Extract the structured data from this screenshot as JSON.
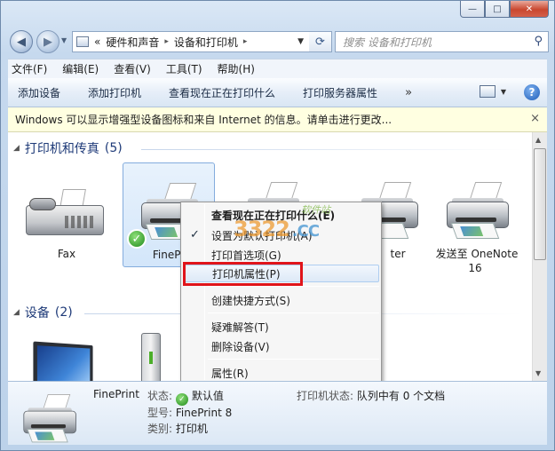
{
  "window": {
    "caption_buttons": {
      "minimize": "—",
      "maximize": "□",
      "close": "✕"
    }
  },
  "nav": {
    "back_icon": "◀",
    "forward_icon": "▶",
    "address": {
      "prefix": "«",
      "segments": [
        "硬件和声音",
        "设备和打印机"
      ],
      "separator": "▸"
    },
    "search_placeholder": "搜索 设备和打印机"
  },
  "menubar": [
    "文件(F)",
    "编辑(E)",
    "查看(V)",
    "工具(T)",
    "帮助(H)"
  ],
  "commandbar": {
    "items": [
      "添加设备",
      "添加打印机",
      "查看现在正在打印什么",
      "打印服务器属性"
    ],
    "more": "»",
    "help": "?"
  },
  "infobar": {
    "text": "Windows 可以显示增强型设备图标和来自 Internet 的信息。请单击进行更改...",
    "close": "×"
  },
  "groups": {
    "printers": {
      "title": "打印机和传真",
      "count": "(5)"
    },
    "devices": {
      "title": "设备",
      "count": "(2)"
    }
  },
  "printers": [
    {
      "label": "Fax"
    },
    {
      "label": "FinePr",
      "selected": true
    },
    {
      "label": ""
    },
    {
      "label": "ter"
    },
    {
      "label": "发送至 OneNote",
      "label2": "16"
    }
  ],
  "context_menu": {
    "items": [
      {
        "label": "查看现在正在打印什么(E)",
        "bold": true
      },
      {
        "label": "设置为默认打印机(A)",
        "checked": true
      },
      {
        "label": "打印首选项(G)"
      },
      {
        "label": "打印机属性(P)",
        "highlighted": true
      },
      {
        "label": "创建快捷方式(S)"
      },
      {
        "label": "疑难解答(T)"
      },
      {
        "label": "删除设备(V)"
      },
      {
        "label": "属性(R)"
      }
    ],
    "check_icon": "✓"
  },
  "watermark": {
    "main": "3322",
    "suffix": ".CC",
    "sub": "软件站"
  },
  "details": {
    "name": "FinePrint",
    "status_key": "状态:",
    "status_value": "默认值",
    "model_key": "型号:",
    "model_value": "FinePrint 8",
    "category_key": "类别:",
    "category_value": "打印机",
    "printer_status_key": "打印机状态:",
    "printer_status_value": "队列中有 0 个文档"
  }
}
